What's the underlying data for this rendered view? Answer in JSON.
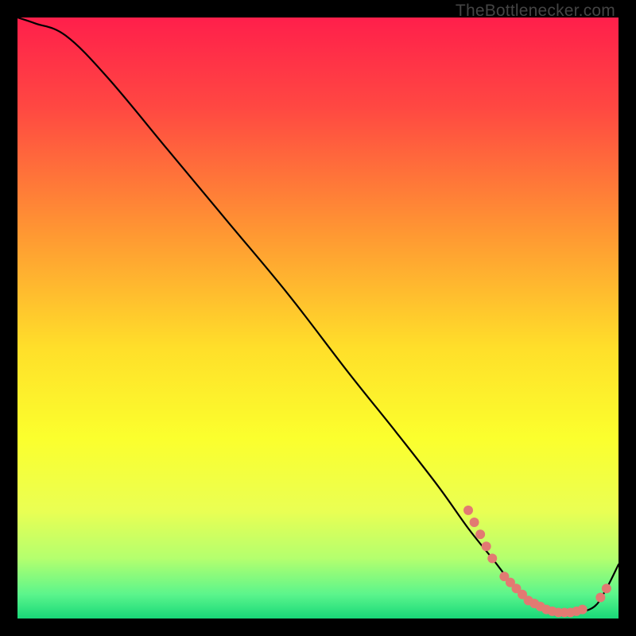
{
  "watermark": "TheBottlenecker.com",
  "chart_data": {
    "type": "line",
    "title": "",
    "xlabel": "",
    "ylabel": "",
    "xlim": [
      0,
      100
    ],
    "ylim": [
      0,
      100
    ],
    "gradient_stops": [
      {
        "pct": 0,
        "color": "#ff1f4b"
      },
      {
        "pct": 15,
        "color": "#ff4842"
      },
      {
        "pct": 35,
        "color": "#ff9433"
      },
      {
        "pct": 55,
        "color": "#ffdf2a"
      },
      {
        "pct": 70,
        "color": "#fbff2d"
      },
      {
        "pct": 82,
        "color": "#eaff53"
      },
      {
        "pct": 90,
        "color": "#b4ff6e"
      },
      {
        "pct": 96,
        "color": "#5bf58c"
      },
      {
        "pct": 100,
        "color": "#18d878"
      }
    ],
    "series": [
      {
        "name": "bottleneck-curve",
        "x": [
          0,
          3,
          8,
          15,
          25,
          35,
          45,
          55,
          63,
          70,
          75,
          79,
          83,
          87,
          90,
          93,
          96,
          98,
          100
        ],
        "y": [
          100,
          99,
          97,
          90,
          78,
          66,
          54,
          41,
          31,
          22,
          15,
          10,
          5,
          2,
          1,
          1,
          2,
          5,
          9
        ]
      }
    ],
    "markers": {
      "name": "highlight-dots",
      "color": "#e27a72",
      "radius_px": 6,
      "points": [
        {
          "x": 75,
          "y": 18
        },
        {
          "x": 76,
          "y": 16
        },
        {
          "x": 77,
          "y": 14
        },
        {
          "x": 78,
          "y": 12
        },
        {
          "x": 79,
          "y": 10
        },
        {
          "x": 81,
          "y": 7
        },
        {
          "x": 82,
          "y": 6
        },
        {
          "x": 83,
          "y": 5
        },
        {
          "x": 84,
          "y": 4
        },
        {
          "x": 85,
          "y": 3
        },
        {
          "x": 86,
          "y": 2.5
        },
        {
          "x": 87,
          "y": 2
        },
        {
          "x": 88,
          "y": 1.5
        },
        {
          "x": 89,
          "y": 1.2
        },
        {
          "x": 90,
          "y": 1
        },
        {
          "x": 91,
          "y": 1
        },
        {
          "x": 92,
          "y": 1
        },
        {
          "x": 93,
          "y": 1.2
        },
        {
          "x": 94,
          "y": 1.5
        },
        {
          "x": 97,
          "y": 3.5
        },
        {
          "x": 98,
          "y": 5
        }
      ]
    }
  }
}
